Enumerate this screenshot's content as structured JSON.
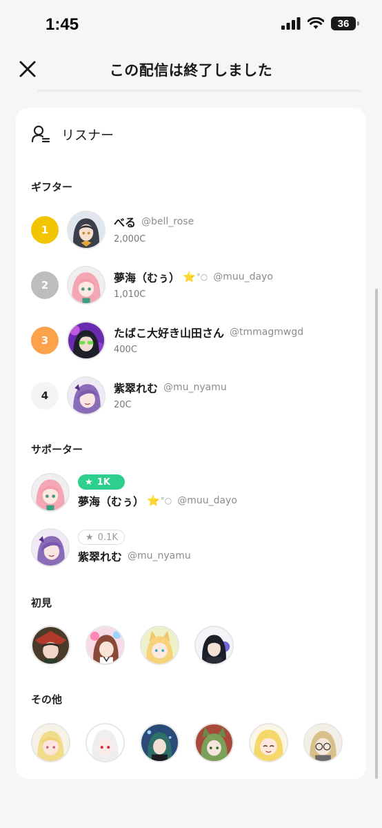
{
  "status": {
    "time": "1:45",
    "battery": "36"
  },
  "header": {
    "title": "この配信は終了しました"
  },
  "card": {
    "title": "リスナー"
  },
  "sections": {
    "gifters": "ギフター",
    "supporters": "サポーター",
    "first_time": "初見",
    "others": "その他"
  },
  "gifters": [
    {
      "rank": "1",
      "name": "べる",
      "handle": "@bell_rose",
      "coins": "2,000C",
      "rank_color": "#f2c500"
    },
    {
      "rank": "2",
      "name": "夢海（むぅ）",
      "handle": "@muu_dayo",
      "coins": "1,010C",
      "rank_color": "#bdbdbd",
      "emoji": "⭐",
      "emoji2": "°○"
    },
    {
      "rank": "3",
      "name": "たばこ大好き山田さん",
      "handle": "@tmmagmwgd",
      "coins": "400C",
      "rank_color": "#fba24b"
    },
    {
      "rank": "4",
      "name": "紫翠れむ",
      "handle": "@mu_nyamu",
      "coins": "20C",
      "rank_color": "#f4f4f4"
    }
  ],
  "supporters": [
    {
      "badge": "1K",
      "name": "夢海（むぅ）",
      "handle": "@muu_dayo",
      "emoji": "⭐",
      "emoji2": "°○"
    },
    {
      "badge": "0.1K",
      "name": "紫翠れむ",
      "handle": "@mu_nyamu"
    }
  ],
  "icons": {
    "close": "close-icon",
    "listener": "listener-icon",
    "star": "star-icon",
    "signal": "signal-icon",
    "wifi": "wifi-icon",
    "battery": "battery-icon"
  },
  "colors": {
    "accent_green": "#2dcf8e",
    "rank1": "#f2c500",
    "rank2": "#bdbdbd",
    "rank3": "#fba24b"
  }
}
